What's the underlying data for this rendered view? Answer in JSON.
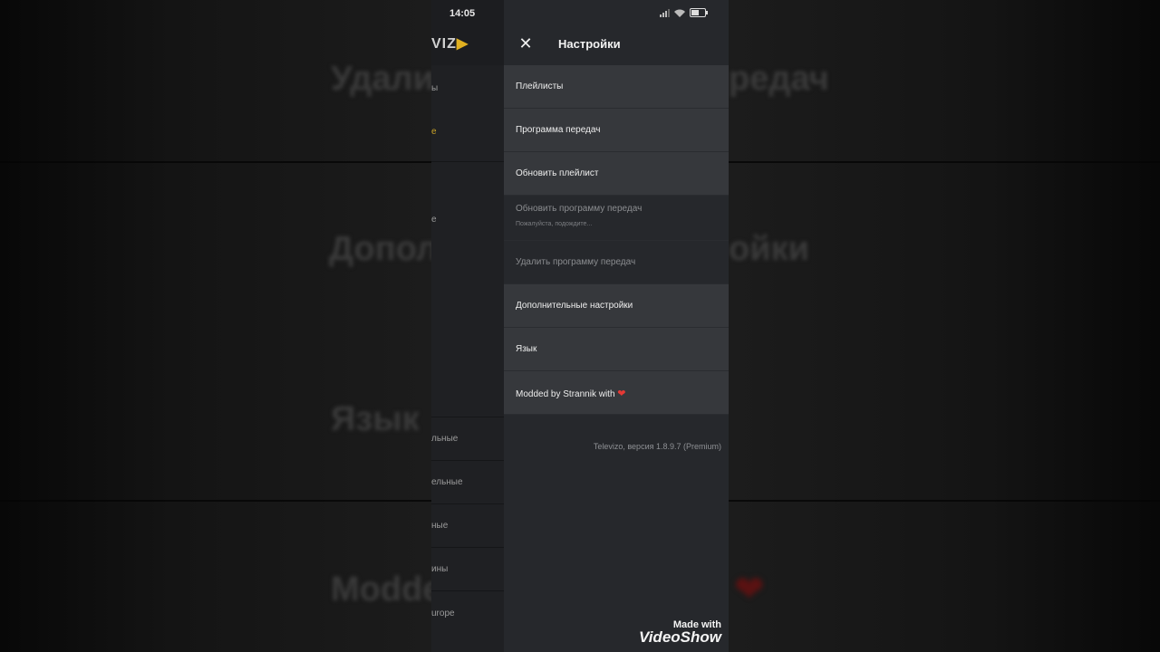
{
  "status_bar": {
    "time": "14:05",
    "battery_level": 0.6
  },
  "behind_screen": {
    "logo": "VIZ",
    "items": [
      "ы",
      "е",
      "е",
      "льные",
      "ельные",
      "ные",
      "ины",
      "urope"
    ]
  },
  "background_echo": {
    "row1": "Удали",
    "row1_right": "редач",
    "row2": "Допол",
    "row2_right": "ойки",
    "row3": "Язык",
    "row4": "Modde"
  },
  "drawer": {
    "title": "Настройки",
    "items": [
      {
        "label": "Плейлисты"
      },
      {
        "label": "Программа передач"
      },
      {
        "label": "Обновить плейлист"
      },
      {
        "label": "Обновить программу передач",
        "sub": "Пожалуйста, подождите..."
      },
      {
        "label": "Удалить программу передач"
      },
      {
        "label": "Дополнительные настройки"
      },
      {
        "label": "Язык"
      },
      {
        "label": "Modded by Strannik with"
      }
    ],
    "version": "Televizo, версия 1.8.9.7 (Premium)"
  },
  "watermark": {
    "line1": "Made with",
    "line2": "VideoShow"
  },
  "colors": {
    "accent": "#c9a227",
    "heart": "#e53935"
  }
}
